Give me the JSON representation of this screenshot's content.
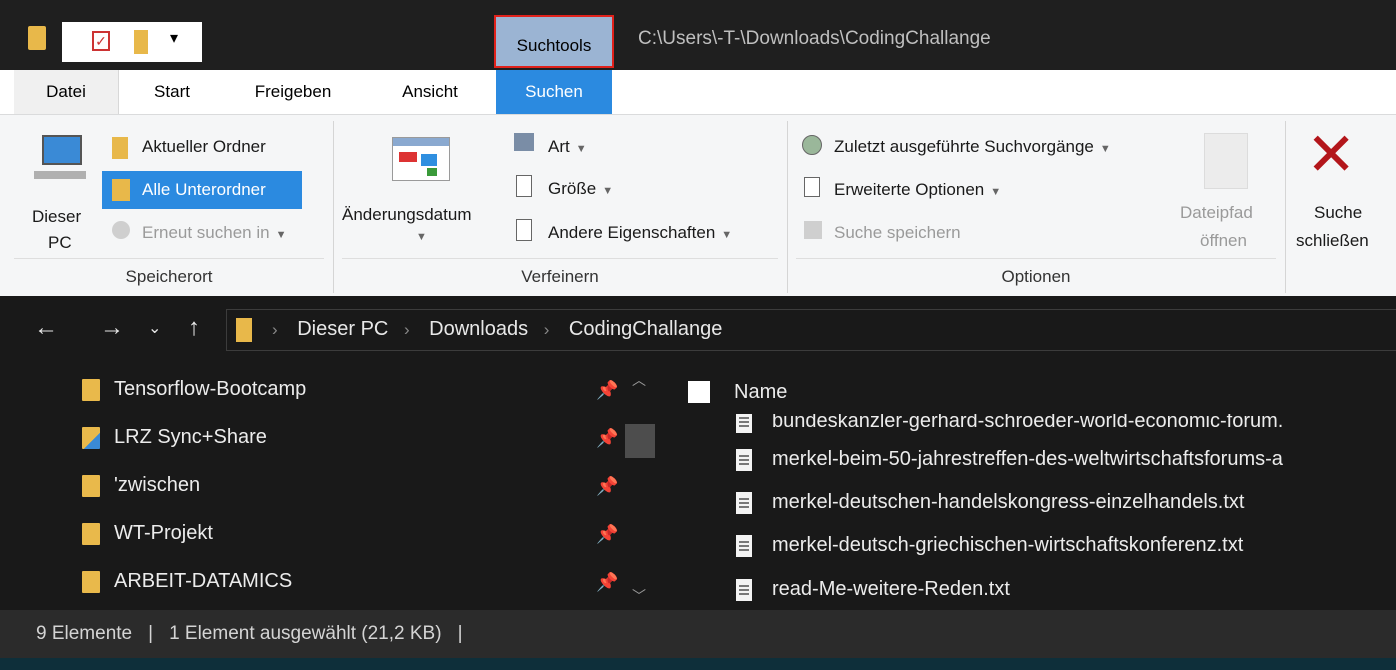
{
  "window": {
    "title_path": "C:\\Users\\-T-\\Downloads\\CodingChallange",
    "context_tab": "Suchtools"
  },
  "ribbon_tabs": [
    "Datei",
    "Start",
    "Freigeben",
    "Ansicht",
    "Suchen"
  ],
  "ribbon": {
    "speicherort": {
      "label": "Speicherort",
      "dieser_pc": [
        "Dieser",
        "PC"
      ],
      "aktueller_ordner": "Aktueller Ordner",
      "alle_unterordner": "Alle Unterordner",
      "erneut_suchen": "Erneut suchen in"
    },
    "verfeinern": {
      "label": "Verfeinern",
      "aenderungsdatum": "Änderungsdatum",
      "art": "Art",
      "groesse": "Größe",
      "andere": "Andere Eigenschaften"
    },
    "optionen": {
      "label": "Optionen",
      "zuletzt": "Zuletzt ausgeführte Suchvorgänge",
      "erweitert": "Erweiterte Optionen",
      "speichern": "Suche speichern",
      "dateipfad": [
        "Dateipfad",
        "öffnen"
      ]
    },
    "schliessen": [
      "Suche",
      "schließen"
    ]
  },
  "breadcrumb": [
    "Dieser PC",
    "Downloads",
    "CodingChallange"
  ],
  "nav_items": [
    "Tensorflow-Bootcamp",
    "LRZ Sync+Share",
    "'zwischen",
    "WT-Projekt",
    "ARBEIT-DATAMICS"
  ],
  "file_header": "Name",
  "files": [
    "bundeskanzler-gerhard-schroeder-world-economic-forum.",
    "merkel-beim-50-jahrestreffen-des-weltwirtschaftsforums-a",
    "merkel-deutschen-handelskongress-einzelhandels.txt",
    "merkel-deutsch-griechischen-wirtschaftskonferenz.txt",
    "read-Me-weitere-Reden.txt"
  ],
  "status": {
    "count": "9 Elemente",
    "selected": "1 Element ausgewählt (21,2 KB)"
  }
}
